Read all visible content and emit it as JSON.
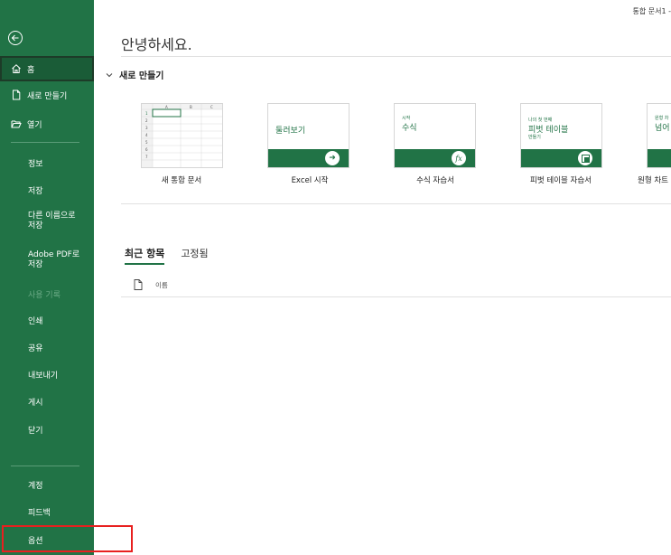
{
  "window": {
    "title": "통합 문서1 -"
  },
  "sidebar": {
    "back_icon": "back-arrow-circle-icon",
    "top_items": [
      {
        "label": "홈",
        "icon": "home-icon"
      },
      {
        "label": "새로 만들기",
        "icon": "new-document-icon"
      },
      {
        "label": "열기",
        "icon": "open-folder-icon"
      }
    ],
    "middle_items": [
      {
        "label": "정보"
      },
      {
        "label": "저장"
      },
      {
        "label": "다른 이름으로\n저장"
      },
      {
        "label": "Adobe PDF로\n저장"
      },
      {
        "label": "사용 기록",
        "disabled": true
      },
      {
        "label": "인쇄"
      },
      {
        "label": "공유"
      },
      {
        "label": "내보내기"
      },
      {
        "label": "게시"
      },
      {
        "label": "닫기"
      }
    ],
    "bottom_items": [
      {
        "label": "계정"
      },
      {
        "label": "피드백"
      },
      {
        "label": "옵션"
      }
    ]
  },
  "main": {
    "greeting": "안녕하세요.",
    "new_section": {
      "label": "새로 만들기"
    },
    "templates": [
      {
        "label": "새 통합 문서"
      },
      {
        "label": "Excel 시작",
        "text": "둘러보기"
      },
      {
        "label": "수식 자습서",
        "small": "시작",
        "text": "수식"
      },
      {
        "label": "피벗 테이블 자습서",
        "small": "나의 첫 번째",
        "text": "피벗 테이블",
        "small2": "만들기"
      },
      {
        "label": "원형 차트",
        "small": "원형 차",
        "text": "넘어"
      }
    ],
    "tabs": [
      {
        "label": "최근 항목",
        "active": true
      },
      {
        "label": "고정됨",
        "active": false
      }
    ],
    "list_header": {
      "name_label": "이름"
    }
  },
  "colors": {
    "accent": "#217346",
    "highlight": "#e8201f"
  }
}
